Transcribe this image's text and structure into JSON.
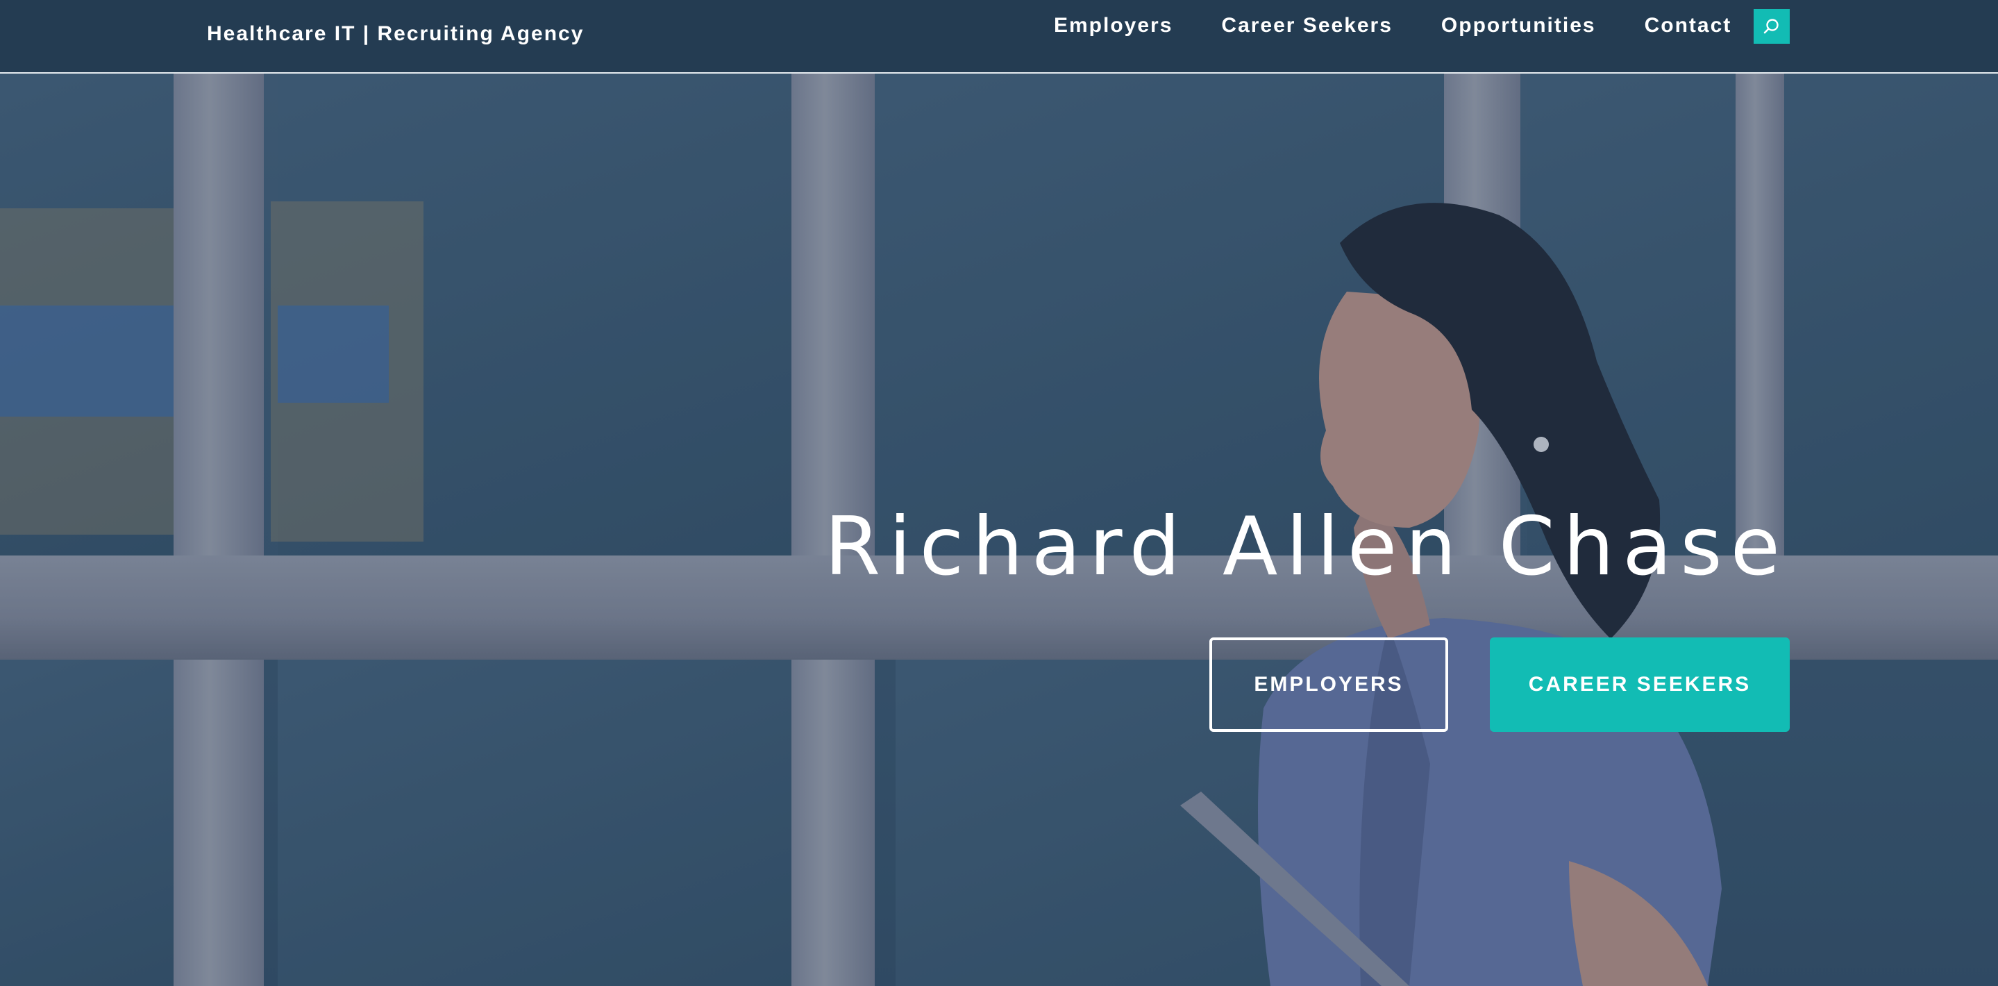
{
  "header": {
    "brand": "Healthcare IT | Recruiting Agency",
    "nav": [
      {
        "label": "Employers"
      },
      {
        "label": "Career Seekers"
      },
      {
        "label": "Opportunities"
      },
      {
        "label": "Contact"
      }
    ],
    "search_icon": "search-icon"
  },
  "hero": {
    "title": "Richard Allen Chase",
    "buttons": {
      "primary_outline": "EMPLOYERS",
      "primary_solid": "CAREER SEEKERS"
    }
  },
  "colors": {
    "header_bg": "#243c52",
    "accent": "#12bcb4",
    "text": "#ffffff"
  }
}
